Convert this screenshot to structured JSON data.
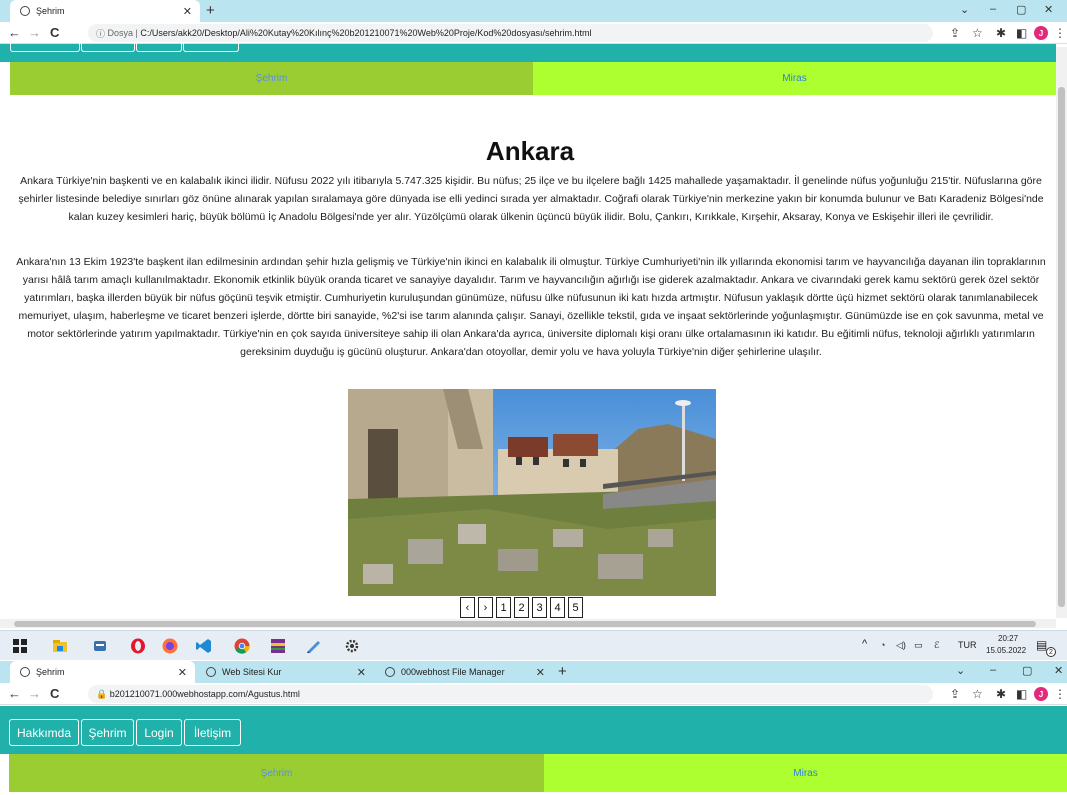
{
  "top_window": {
    "tabs": [
      {
        "label": "Şehrim",
        "active": true
      }
    ],
    "new_tab": "+",
    "window_controls": [
      "⌄",
      "–",
      "▢",
      "✕"
    ],
    "address": {
      "prefix": "Dosya",
      "url": "C:/Users/akk20/Desktop/Ali%20Kutay%20Kılınç%20b201210071%20Web%20Proje/Kod%20dosyası/sehrim.html"
    },
    "avatar_letter": "J",
    "sections": {
      "left": "Şehrim",
      "right": "Miras"
    },
    "heading": "Ankara",
    "paragraphs": [
      "Ankara Türkiye'nin başkenti ve en kalabalık ikinci ilidir. Nüfusu 2022 yılı itibarıyla 5.747.325 kişidir. Bu nüfus; 25 ilçe ve bu ilçelere bağlı 1425 mahallede yaşamaktadır. İl genelinde nüfus yoğunluğu 215'tir. Nüfuslarına göre şehirler listesinde belediye sınırları göz önüne alınarak yapılan sıralamaya göre dünyada ise elli yedinci sırada yer almaktadır. Coğrafi olarak Türkiye'nin merkezine yakın bir konumda bulunur ve Batı Karadeniz Bölgesi'nde kalan kuzey kesimleri hariç, büyük bölümü İç Anadolu Bölgesi'nde yer alır. Yüzölçümü olarak ülkenin üçüncü büyük ilidir. Bolu, Çankırı, Kırıkkale, Kırşehir, Aksaray, Konya ve Eskişehir illeri ile çevrilidir.",
      "Ankara'nın 13 Ekim 1923'te başkent ilan edilmesinin ardından şehir hızla gelişmiş ve Türkiye'nin ikinci en kalabalık ili olmuştur. Türkiye Cumhuriyeti'nin ilk yıllarında ekonomisi tarım ve hayvancılığa dayanan ilin topraklarının yarısı hâlâ tarım amaçlı kullanılmaktadır. Ekonomik etkinlik büyük oranda ticaret ve sanayiye dayalıdır. Tarım ve hayvancılığın ağırlığı ise giderek azalmaktadır. Ankara ve civarındaki gerek kamu sektörü gerek özel sektör yatırımları, başka illerden büyük bir nüfus göçünü teşvik etmiştir. Cumhuriyetin kuruluşundan günümüze, nüfusu ülke nüfusunun iki katı hızda artmıştır. Nüfusun yaklaşık dörtte üçü hizmet sektörü olarak tanımlanabilecek memuriyet, ulaşım, haberleşme ve ticaret benzeri işlerde, dörtte biri sanayide, %2'si ise tarım alanında çalışır. Sanayi, özellikle tekstil, gıda ve inşaat sektörlerinde yoğunlaşmıştır. Günümüzde ise en çok savunma, metal ve motor sektörlerinde yatırım yapılmaktadır. Türkiye'nin en çok sayıda üniversiteye sahip ili olan Ankara'da ayrıca, üniversite diplomalı kişi oranı ülke ortalamasının iki katıdır. Bu eğitimli nüfus, teknoloji ağırlıklı yatırımların gereksinim duyduğu iş gücünü oluşturur. Ankara'dan otoyollar, demir yolu ve hava yoluyla Türkiye'nin diğer şehirlerine ulaşılır."
    ],
    "pager": [
      "‹",
      "›",
      "1",
      "2",
      "3",
      "4",
      "5"
    ]
  },
  "taskbar": {
    "language": "TUR",
    "time": "20:27",
    "date": "15.05.2022",
    "notifications": "2"
  },
  "bottom_window": {
    "tabs": [
      {
        "label": "Şehrim",
        "active": true
      },
      {
        "label": "Web Sitesi Kur",
        "active": false
      },
      {
        "label": "000webhost File Manager",
        "active": false
      }
    ],
    "new_tab": "+",
    "address": {
      "url": "b201210071.000webhostapp.com/Agustus.html"
    },
    "avatar_letter": "J",
    "nav": [
      "Hakkımda",
      "Şehrim",
      "Login",
      "İletişim"
    ],
    "sections": {
      "left": "Şehrim",
      "right": "Miras"
    }
  },
  "colors": {
    "teal": "#20b2aa",
    "section_left": "#9acd32",
    "section_right": "#adff2f",
    "tabbar": "#b9e4f0"
  }
}
